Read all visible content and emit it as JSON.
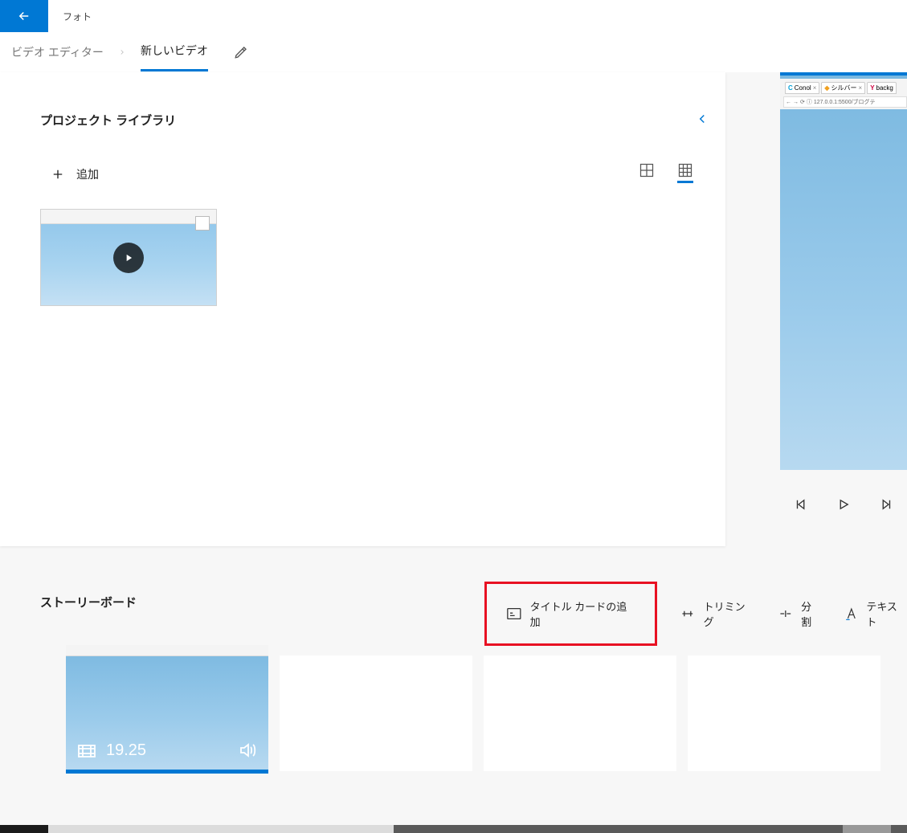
{
  "app": {
    "title": "フォト"
  },
  "breadcrumb": {
    "editor": "ビデオ エディター",
    "project": "新しいビデオ"
  },
  "library": {
    "title": "プロジェクト ライブラリ",
    "add": "追加"
  },
  "preview": {
    "tabs": [
      {
        "favicon": "C",
        "label": "Conol",
        "color": "#00a0d8"
      },
      {
        "favicon": "◆",
        "label": "シルバー",
        "color": "#f0a020"
      },
      {
        "favicon": "Y",
        "label": "backg",
        "color": "#d00040"
      }
    ],
    "url": "127.0.0.1:5500/ブログテ"
  },
  "storyboard": {
    "title": "ストーリーボード",
    "tools": {
      "titlecard": "タイトル カードの追加",
      "trim": "トリミング",
      "split": "分割",
      "text": "テキスト"
    },
    "clip_duration": "19.25"
  }
}
